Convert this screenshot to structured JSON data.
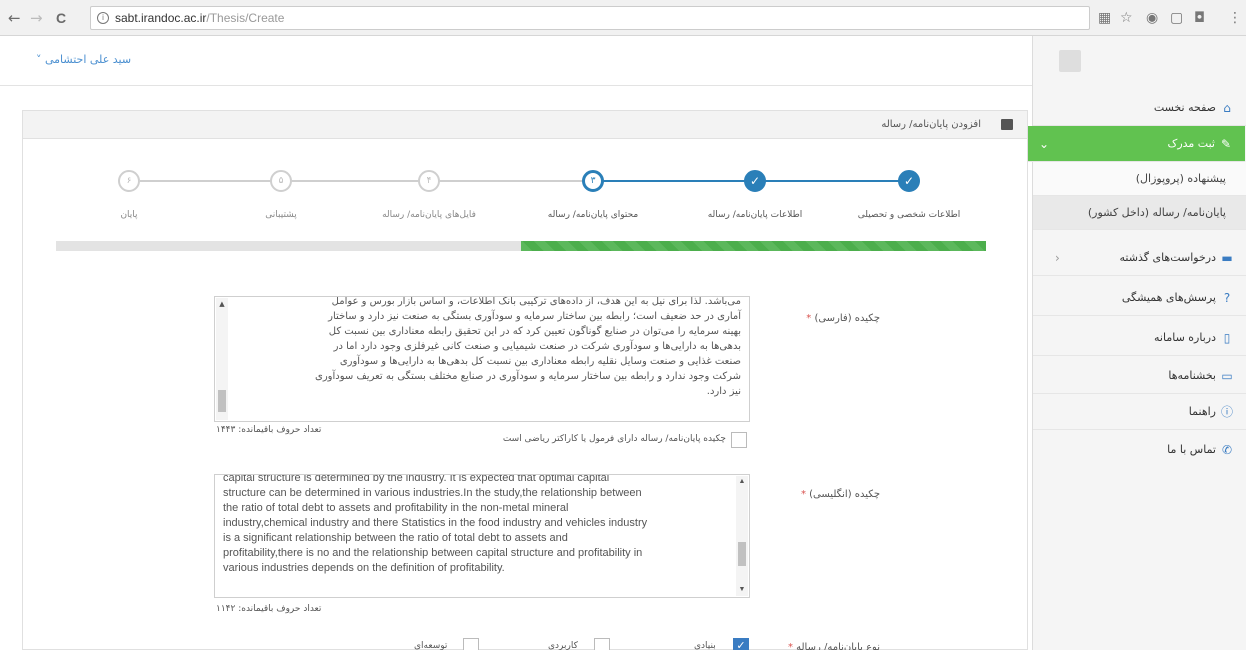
{
  "browser": {
    "url_host": "sabt.irandoc.ac.ir",
    "url_path": "/Thesis/Create",
    "back": "←",
    "forward": "→",
    "reload": "C"
  },
  "header": {
    "user_name": "سید علی احتشامی ˅"
  },
  "sidebar": {
    "items": [
      {
        "label": "صفحه نخست",
        "icon": "home-icon"
      },
      {
        "label": "ثبت مدرک",
        "icon": "edit-icon"
      },
      {
        "label": "درخواست‌های گذشته",
        "icon": "list-icon"
      },
      {
        "label": "پرسش‌های همیشگی",
        "icon": "help-icon"
      },
      {
        "label": "درباره سامانه",
        "icon": "document-icon"
      },
      {
        "label": "بخشنامه‌ها",
        "icon": "folder-icon"
      },
      {
        "label": "راهنما",
        "icon": "info-icon"
      },
      {
        "label": "تماس با ما",
        "icon": "phone-icon"
      }
    ],
    "subitems": [
      {
        "label": "پیشنهاده (پروپوزال)"
      },
      {
        "label": "پایان‌نامه/ رساله (داخل کشور)"
      }
    ]
  },
  "panel": {
    "title": "افزودن پایان‌نامه/ رساله"
  },
  "wizard": {
    "steps": [
      {
        "label": "اطلاعات شخصی و تحصیلی",
        "state": "done",
        "symbol": "✓"
      },
      {
        "label": "اطلاعات پایان‌نامه/ رساله",
        "state": "done",
        "symbol": "✓"
      },
      {
        "label": "محتوای پایان‌نامه/ رساله",
        "state": "current",
        "symbol": "۳"
      },
      {
        "label": "فایل‌های پایان‌نامه/ رساله",
        "state": "todo",
        "symbol": "۴"
      },
      {
        "label": "پشتیبانی",
        "state": "todo",
        "symbol": "۵"
      },
      {
        "label": "پایان",
        "state": "todo",
        "symbol": "۶"
      }
    ],
    "progress": 0.5
  },
  "form": {
    "abstract_fa_label": "چکیده (فارسی)",
    "abstract_fa_lines": [
      "می‌باشد. لذا برای نیل به این هدف، از داده‌های ترکیبی بانک اطلاعات، و اساس بازار بورس و عوامل",
      "آماری در حد ضعیف است؛ رابطه بین ساختار سرمایه و سودآوری بستگی به صنعت نیز دارد و ساختار",
      "بهینه سرمایه را می‌توان در صنایع گوناگون تعیین کرد که در این تحقیق رابطه معناداری بین نسبت کل",
      "بدهی‌ها به دارایی‌ها و سودآوری شرکت در صنعت شیمیایی و صنعت کانی غیرفلزی وجود دارد اما در",
      "صنعت غذایی و صنعت وسایل نقلیه رابطه معناداری بین نسبت کل بدهی‌ها به دارایی‌ها و سودآوری",
      "شرکت وجود ندارد و رابطه بین ساختار سرمایه و سودآوری در صنایع مختلف بستگی به تعریف سودآوری",
      "نیز دارد."
    ],
    "abstract_fa_counter": "تعداد حروف باقیمانده: ۱۴۴۳",
    "formula_checkbox_label": "چکیده پایان‌نامه/ رساله دارای فرمول یا کاراکتر ریاضی است",
    "abstract_en_label": "چکیده (انگلیسی)",
    "abstract_en_lines": [
      "capital structure is determined by the industry. It is expected that optimal capital",
      "structure can be determined in various industries.In the study,the relationship between",
      "the ratio of total debt to assets and profitability in the non-metal mineral",
      "industry,chemical industry and there Statistics in the food industry and vehicles industry",
      "is a significant relationship between the ratio of total debt to assets and",
      "profitability,there is no and the relationship between capital structure and profitability in",
      "various industries depends on the definition of profitability."
    ],
    "abstract_en_counter": "تعداد حروف باقیمانده: ۱۱۴۲",
    "type_label": "نوع پایان‌نامه/ رساله",
    "type_options": [
      {
        "label": "بنیادی",
        "checked": true
      },
      {
        "label": "کاربردی",
        "checked": false
      },
      {
        "label": "توسعه‌ای",
        "checked": false
      }
    ]
  }
}
